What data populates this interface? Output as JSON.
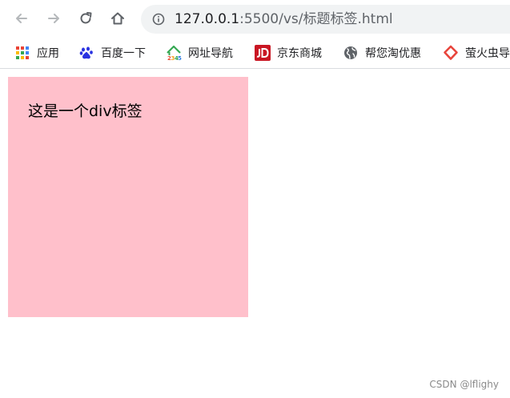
{
  "address_bar": {
    "host": "127.0.0.1",
    "path": ":5500/vs/标题标签.html"
  },
  "bookmarks": [
    {
      "label": "应用",
      "icon": "apps-grid-icon"
    },
    {
      "label": "百度一下",
      "icon": "baidu-paw-icon"
    },
    {
      "label": "网址导航",
      "icon": "hao123-house-icon"
    },
    {
      "label": "京东商城",
      "icon": "jd-logo-icon"
    },
    {
      "label": "帮您淘优惠",
      "icon": "globe-icon"
    },
    {
      "label": "萤火虫导",
      "icon": "firefly-icon"
    }
  ],
  "page": {
    "div_text": "这是一个div标签",
    "div_color": "#ffc0cb"
  },
  "watermark": "CSDN @lflighy"
}
